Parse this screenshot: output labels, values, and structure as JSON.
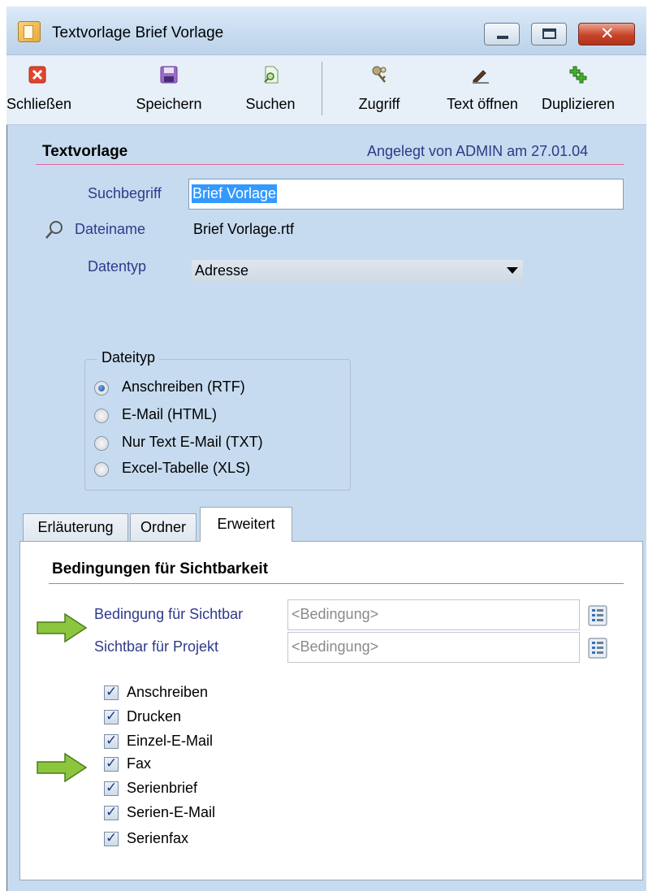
{
  "window": {
    "title": "Textvorlage Brief Vorlage",
    "app_icon": "document-pen-icon",
    "caption_buttons": [
      "minimize-icon",
      "maximize-icon",
      "close-icon"
    ]
  },
  "toolbar": {
    "items": [
      {
        "label": "Schließen",
        "icon": "close-red-x-icon"
      },
      {
        "label": "Speichern",
        "icon": "save-disk-icon"
      },
      {
        "label": "Suchen",
        "icon": "search-document-icon"
      },
      {
        "label": "Zugriff",
        "icon": "keys-icon"
      },
      {
        "label": "Text öffnen",
        "icon": "edit-pen-icon"
      },
      {
        "label": "Duplizieren",
        "icon": "duplicate-plus-icon"
      }
    ]
  },
  "form": {
    "section_title": "Textvorlage",
    "created_info": "Angelegt von ADMIN am 27.01.04",
    "suchbegriff_label": "Suchbegriff",
    "suchbegriff_value": "Brief Vorlage",
    "dateiname_label": "Dateiname",
    "dateiname_value": "Brief Vorlage.rtf",
    "datentyp_label": "Datentyp",
    "datentyp_value": "Adresse"
  },
  "dateityp": {
    "legend": "Dateityp",
    "options": [
      {
        "label": "Anschreiben (RTF)",
        "selected": true
      },
      {
        "label": "E-Mail (HTML)",
        "selected": false
      },
      {
        "label": "Nur Text E-Mail (TXT)",
        "selected": false
      },
      {
        "label": "Excel-Tabelle (XLS)",
        "selected": false
      }
    ]
  },
  "tabs": [
    {
      "label": "Erläuterung",
      "active": false
    },
    {
      "label": "Ordner",
      "active": false
    },
    {
      "label": "Erweitert",
      "active": true
    }
  ],
  "erweitert": {
    "section_title": "Bedingungen für Sichtbarkeit",
    "condition_rows": [
      {
        "label": "Bedingung für Sichtbar",
        "placeholder": "<Bedingung>"
      },
      {
        "label": "Sichtbar für Projekt",
        "placeholder": "<Bedingung>"
      }
    ],
    "checkboxes": [
      {
        "label": "Anschreiben",
        "checked": true
      },
      {
        "label": "Drucken",
        "checked": true
      },
      {
        "label": "Einzel-E-Mail",
        "checked": true
      },
      {
        "label": "Fax",
        "checked": true
      },
      {
        "label": "Serienbrief",
        "checked": true
      },
      {
        "label": "Serien-E-Mail",
        "checked": true
      },
      {
        "label": "Serienfax",
        "checked": true
      }
    ]
  },
  "colors": {
    "window_bg": "#c6dbef",
    "label_blue": "#2e3a8c",
    "rule_pink": "#e2669a",
    "arrow_green": "#8cc63f",
    "selection_blue": "#3399ff"
  }
}
